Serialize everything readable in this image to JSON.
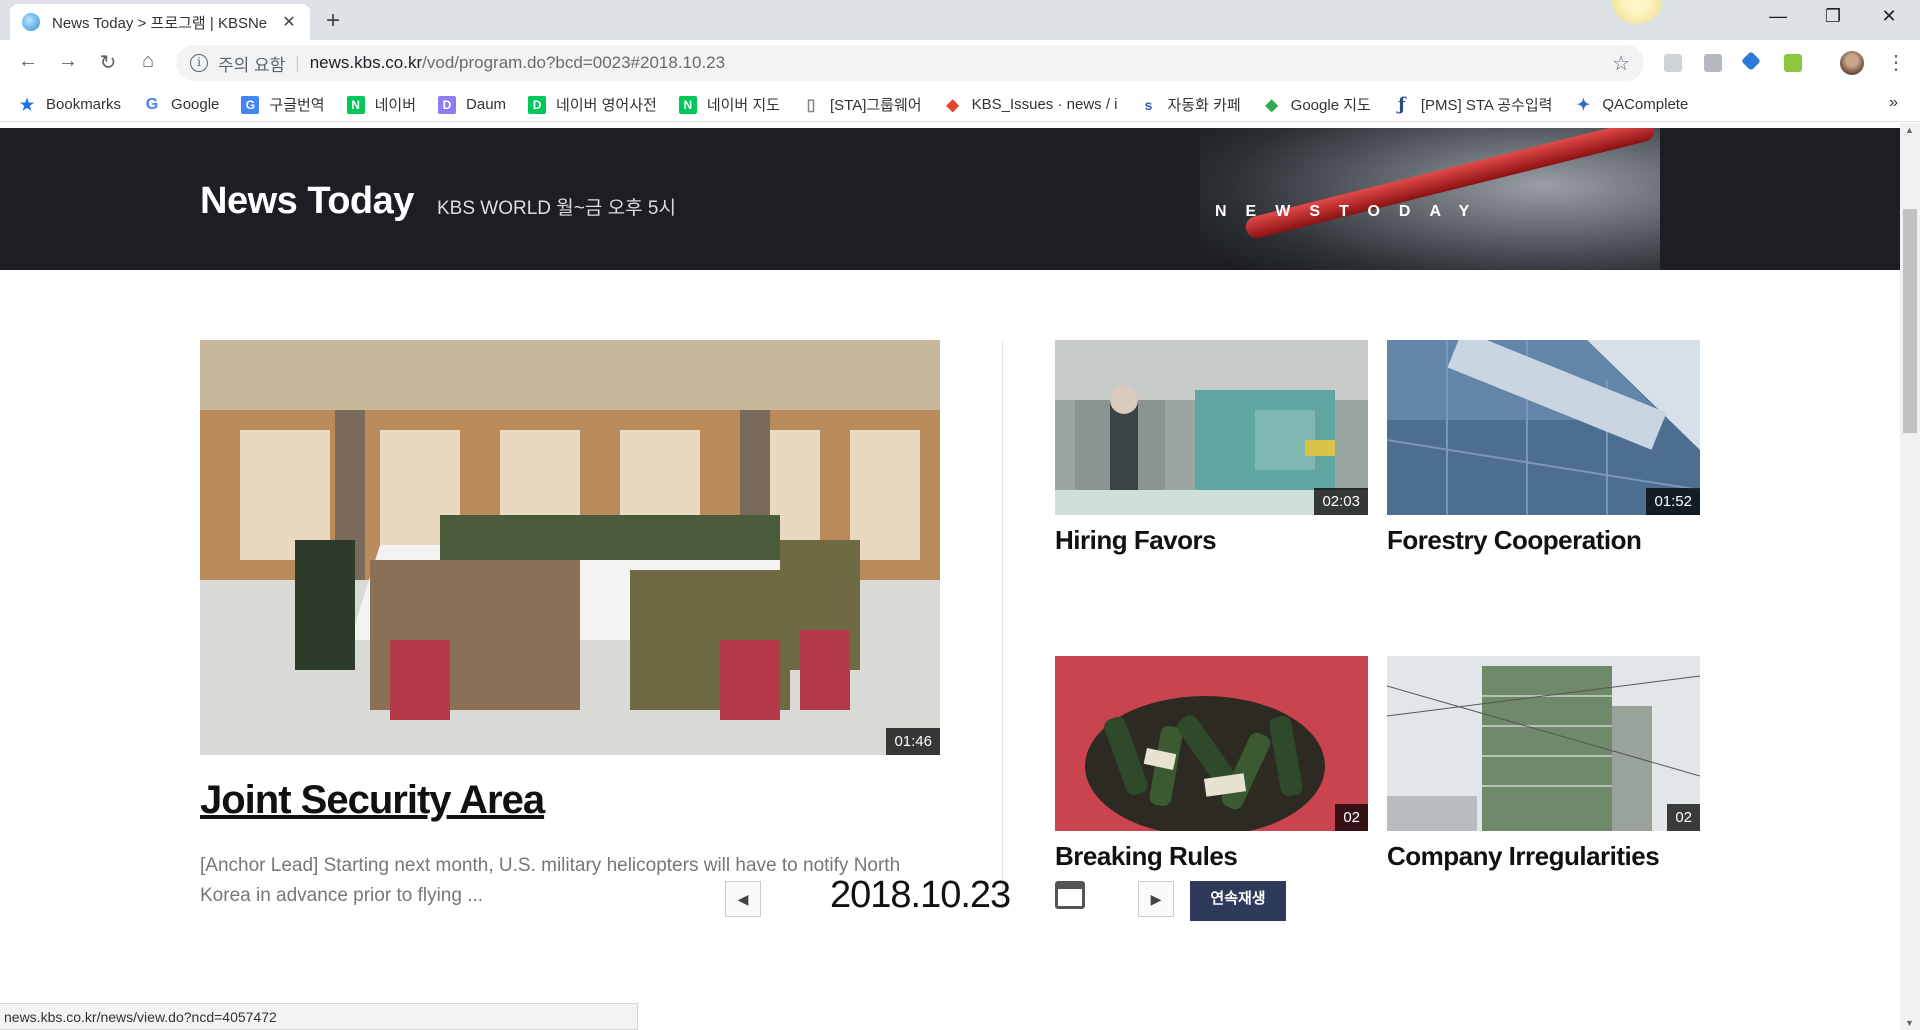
{
  "tab": {
    "title": "News Today > 프로그램 | KBSNe",
    "close": "✕",
    "new_tab": "+"
  },
  "window": {
    "minimize": "—",
    "restore": "❐",
    "close": "✕"
  },
  "nav": {
    "back": "←",
    "forward": "→",
    "reload": "↻",
    "home": "⌂"
  },
  "address": {
    "info": "i",
    "security": "주의 요함",
    "separator": "|",
    "host": "news.kbs.co.kr",
    "path": "/vod/program.do?bcd=0023#2018.10.23",
    "star": "☆"
  },
  "menu_dots": "⋮",
  "bookmarks": {
    "items": [
      {
        "label": "Bookmarks",
        "icon": "star-icon",
        "glyph": "★",
        "color": "#1a73e8"
      },
      {
        "label": "Google",
        "icon": "google-icon",
        "glyph": "G",
        "color": "#4285f4"
      },
      {
        "label": "구글번역",
        "icon": "translate-icon",
        "glyph": "G",
        "color": "#4285f4"
      },
      {
        "label": "네이버",
        "icon": "naver-icon",
        "glyph": "N",
        "color": "#03c75a"
      },
      {
        "label": "Daum",
        "icon": "daum-icon",
        "glyph": "D",
        "color": "#8e7cf2"
      },
      {
        "label": "네이버 영어사전",
        "icon": "dict-icon",
        "glyph": "D",
        "color": "#03c75a"
      },
      {
        "label": "네이버 지도",
        "icon": "naver-map-icon",
        "glyph": "N",
        "color": "#03c75a"
      },
      {
        "label": "[STA]그룹웨어",
        "icon": "page-icon",
        "glyph": "▯",
        "color": "#888888"
      },
      {
        "label": "KBS_Issues · news / i",
        "icon": "gitlab-icon",
        "glyph": "◆",
        "color": "#e24329"
      },
      {
        "label": "자동화 카페",
        "icon": "sta-icon",
        "glyph": "s",
        "color": "#3b5bb5"
      },
      {
        "label": "Google 지도",
        "icon": "google-maps-icon",
        "glyph": "◆",
        "color": "#34a853"
      },
      {
        "label": "[PMS] STA 공수입력",
        "icon": "pms-icon",
        "glyph": "ƒ",
        "color": "#2a4a8a"
      },
      {
        "label": "QAComplete",
        "icon": "qacomplete-icon",
        "glyph": "✦",
        "color": "#2a6bd1"
      }
    ],
    "more": "»"
  },
  "banner": {
    "title": "News Today",
    "subtitle": "KBS WORLD 월~금 오후 5시",
    "logo_text": "NEWSTODAY"
  },
  "hero": {
    "title": "Joint Security Area",
    "duration": "01:46",
    "description": "[Anchor Lead] Starting next month, U.S. military helicopters will have to notify North Korea in advance prior to flying ..."
  },
  "cards": [
    {
      "title": "Hiring Favors",
      "duration": "02:03"
    },
    {
      "title": "Forestry Cooperation",
      "duration": "01:52"
    },
    {
      "title": "Breaking Rules",
      "duration": "02"
    },
    {
      "title": "Company Irregularities",
      "duration": "02"
    }
  ],
  "datebar": {
    "prev": "◀",
    "next": "▶",
    "date": "2018.10.23",
    "autoplay": "연속재생"
  },
  "status_url": "news.kbs.co.kr/news/view.do?ncd=4057472",
  "scrollbar": {
    "up": "▲",
    "down": "▼"
  }
}
